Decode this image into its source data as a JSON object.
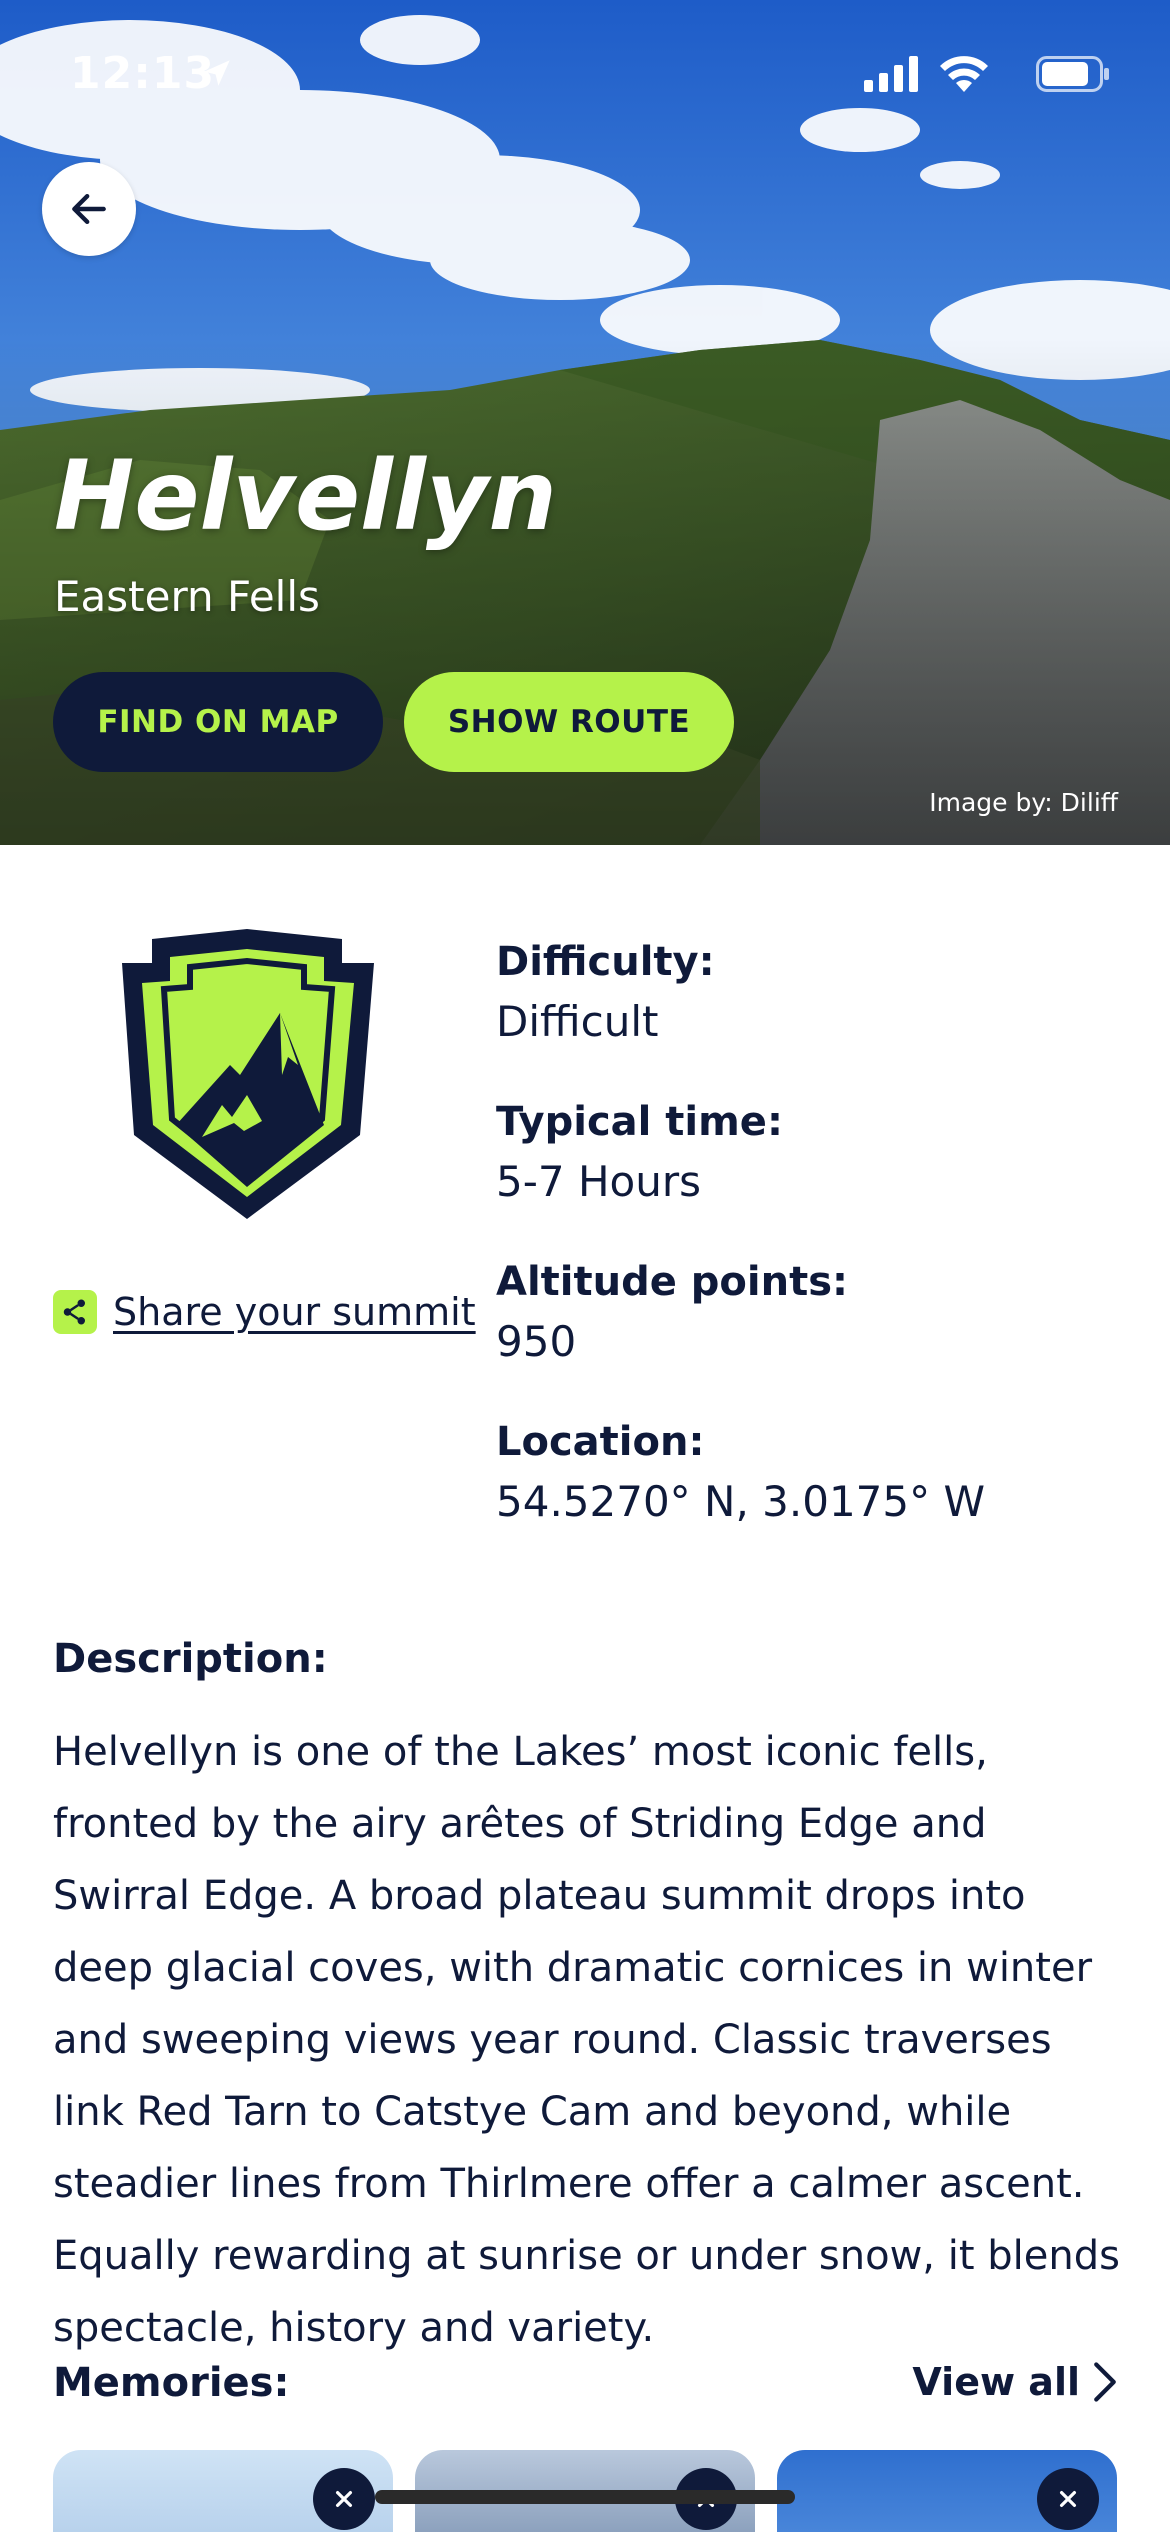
{
  "status_bar": {
    "time": "12:13"
  },
  "hero": {
    "title": "Helvellyn",
    "subtitle": "Eastern Fells",
    "find_on_map_label": "FIND ON MAP",
    "show_route_label": "SHOW ROUTE",
    "image_credit": "Image by: Diliff"
  },
  "share": {
    "label": "Share your summit"
  },
  "facts": [
    {
      "label": "Difficulty:",
      "value": "Difficult"
    },
    {
      "label": "Typical time:",
      "value": "5-7 Hours"
    },
    {
      "label": "Altitude points:",
      "value": "950"
    },
    {
      "label": "Location:",
      "value": "54.5270° N, 3.0175° W"
    }
  ],
  "description": {
    "heading": "Description:",
    "text": "Helvellyn is one of the Lakes’ most iconic fells, fronted by the airy arêtes of Striding Edge and Swirral Edge. A broad plateau summit drops into deep glacial coves, with dramatic cornices in winter and sweeping views year round. Classic traverses link Red Tarn to Catstye Cam and beyond, while steadier lines from Thirlmere offer a calmer ascent. Equally rewarding at sunrise or under snow, it blends spectacle, history and variety."
  },
  "memories": {
    "heading": "Memories:",
    "view_all_label": "View all"
  },
  "colors": {
    "navy": "#0f1a3a",
    "lime": "#b5f24a"
  },
  "icons": [
    "location-arrow-icon",
    "signal-icon",
    "wifi-icon",
    "battery-icon",
    "back-arrow-icon",
    "summit-badge-icon",
    "share-icon",
    "chevron-right-icon",
    "close-icon"
  ]
}
